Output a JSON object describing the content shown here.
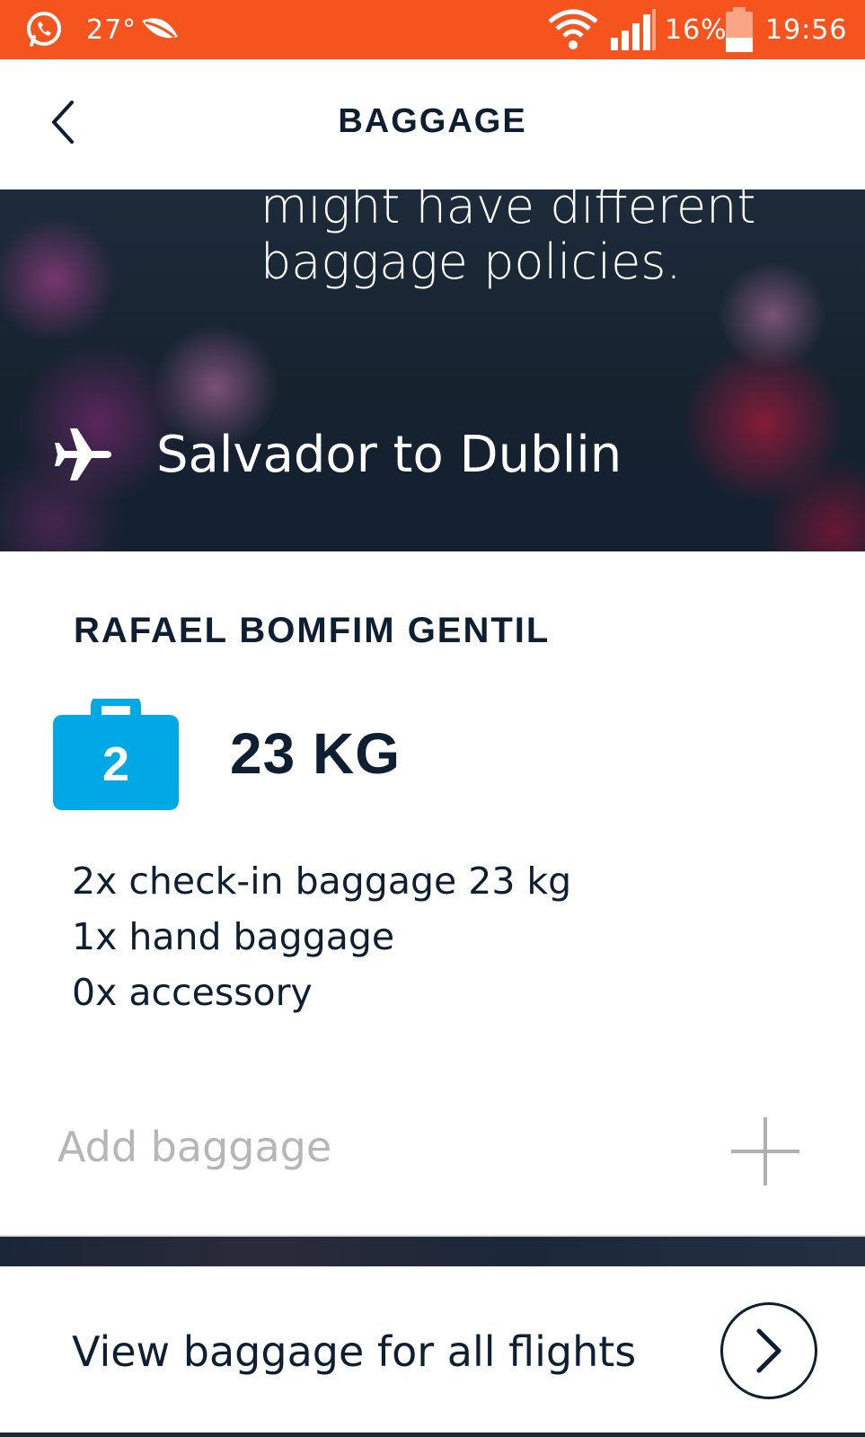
{
  "status_bar": {
    "background": "#f5541f",
    "temperature": "27°",
    "battery": "16%",
    "time": "19:56",
    "icons": [
      "whatsapp-icon",
      "leaf-icon",
      "wifi-icon",
      "signal-icon",
      "battery-icon"
    ]
  },
  "header": {
    "back_icon": "chevron-left-icon",
    "title": "BAGGAGE"
  },
  "hero": {
    "description_lines": [
      "might have different",
      "baggage policies."
    ],
    "route_icon": "airplane-icon",
    "route": "Salvador to Dublin"
  },
  "passenger": {
    "name": "RAFAEL BOMFIM GENTIL",
    "bag_icon": "suitcase-icon",
    "bag_color": "#00a9e6",
    "bag_count": "2",
    "weight": "23 KG",
    "allowance": [
      "2x check-in baggage 23 kg",
      "1x hand baggage",
      "0x accessory"
    ]
  },
  "add_baggage": {
    "label": "Add baggage",
    "icon": "plus-icon"
  },
  "footer": {
    "label": "View baggage for all flights",
    "icon": "chevron-right-circle-icon"
  }
}
